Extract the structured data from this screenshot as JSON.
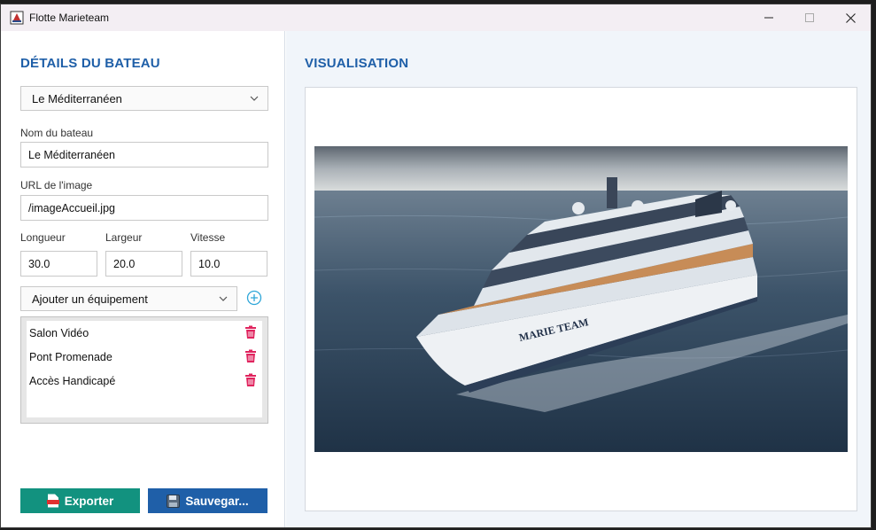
{
  "window": {
    "title": "Flotte Marieteam"
  },
  "left": {
    "section_title": "DÉTAILS DU BATEAU",
    "boat_select": "Le Méditerranéen",
    "name_label": "Nom du bateau",
    "name_value": "Le Méditerranéen",
    "url_label": "URL de l'image",
    "url_value": "/imageAccueil.jpg",
    "length_label": "Longueur",
    "length_value": "30.0",
    "width_label": "Largeur",
    "width_value": "20.0",
    "speed_label": "Vitesse",
    "speed_value": "10.0",
    "equipment_select": "Ajouter un équipement",
    "equipment": [
      "Salon Vidéo",
      "Pont Promenade",
      "Accès Handicapé"
    ],
    "export_label": "Exporter",
    "save_label": "Sauvegar..."
  },
  "right": {
    "section_title": "VISUALISATION",
    "ship_name": "MARIE TEAM"
  },
  "colors": {
    "accent": "#1f5fa8",
    "export": "#12927f",
    "delete": "#e0245e"
  }
}
